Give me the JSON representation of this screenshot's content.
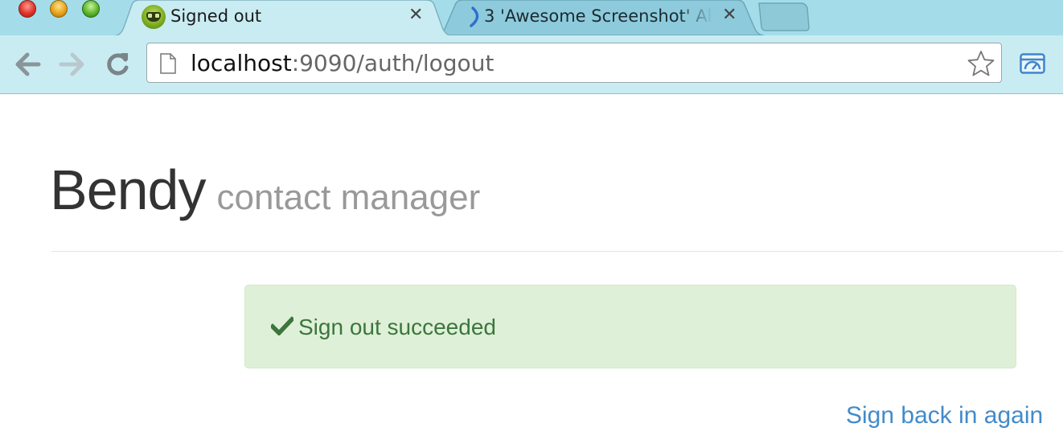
{
  "browser": {
    "tabs": [
      {
        "title": "Signed out",
        "active": true
      },
      {
        "title": "3 'Awesome Screenshot' Al",
        "active": false
      }
    ],
    "url": {
      "host": "localhost",
      "rest": ":9090/auth/logout"
    },
    "icons": [
      "close-window-icon",
      "minimize-window-icon",
      "zoom-window-icon",
      "back-arrow-icon",
      "forward-arrow-icon",
      "reload-icon",
      "page-icon",
      "star-icon",
      "extension-icon"
    ]
  },
  "page": {
    "brand": {
      "name": "Bendy",
      "subtitle": "contact manager"
    },
    "alert": {
      "message": "Sign out succeeded",
      "icon": "checkmark-icon"
    },
    "link": {
      "label": "Sign back in again"
    }
  },
  "colors": {
    "alert_bg": "#dff0d8",
    "alert_text": "#3c763d",
    "link": "#428bca",
    "chrome_bg": "#c9ecf3"
  }
}
